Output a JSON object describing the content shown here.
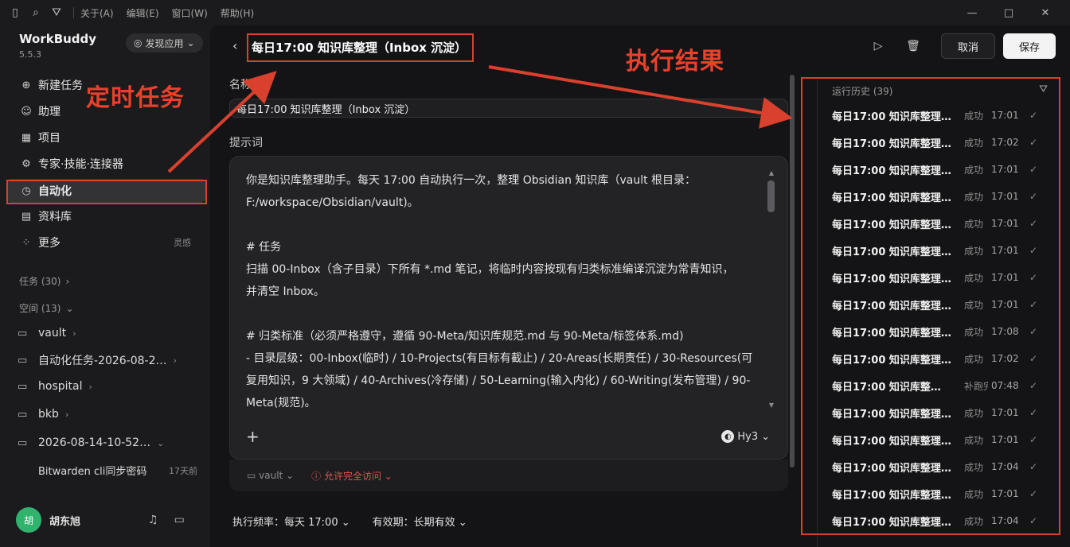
{
  "topbar": {
    "menus": [
      "关于(A)",
      "编辑(E)",
      "窗口(W)",
      "帮助(H)"
    ]
  },
  "app": {
    "name": "WorkBuddy",
    "version": "5.5.3",
    "discover_label": "发现应用"
  },
  "nav": [
    {
      "label": "新建任务",
      "icon": "plus-circle-icon"
    },
    {
      "label": "助理",
      "icon": "robot-icon"
    },
    {
      "label": "项目",
      "icon": "grid-icon"
    },
    {
      "label": "专家·技能·连接器",
      "icon": "puzzle-icon"
    },
    {
      "label": "自动化",
      "icon": "clock-icon"
    },
    {
      "label": "资料库",
      "icon": "book-icon"
    },
    {
      "label": "更多",
      "icon": "apps-icon",
      "aside": "灵感"
    }
  ],
  "sections": {
    "tasks": "任务 (30)",
    "spaces": "空间 (13)"
  },
  "folders": [
    {
      "label": "vault"
    },
    {
      "label": "自动化任务-2026-08-2…"
    },
    {
      "label": "hospital"
    },
    {
      "label": "bkb"
    },
    {
      "label": "2026-08-14-10-52…"
    }
  ],
  "subitem": {
    "label": "Bitwarden cli同步密码",
    "ago": "17天前"
  },
  "user": {
    "name": "胡东旭",
    "avatar_text": "胡"
  },
  "task": {
    "title": "每日17:00 知识库整理（Inbox 沉淀）",
    "name_label": "名称",
    "name_value": "每日17:00 知识库整理（Inbox 沉淀）",
    "prompt_label": "提示词",
    "prompt_lines": [
      "你是知识库整理助手。每天 17:00 自动执行一次，整理 Obsidian 知识库（vault 根目录：",
      "F:/workspace/Obsidian/vault)。",
      "",
      "# 任务",
      "扫描 00-Inbox（含子目录）下所有 *.md 笔记，将临时内容按现有归类标准编译沉淀为常青知识，",
      "并清空 Inbox。",
      "",
      "# 归类标准（必须严格遵守，遵循 90-Meta/知识库规范.md 与 90-Meta/标签体系.md)",
      "- 目录层级：00-Inbox(临时) / 10-Projects(有目标有截止) / 20-Areas(长期责任) / 30-Resources(可",
      "复用知识，9 大领域) / 40-Archives(冷存储) / 50-Learning(输入内化) / 60-Writing(发布管理) / 90-",
      "Meta(规范)。"
    ],
    "model": "Hy3",
    "workspace": "vault",
    "access": "允许完全访问",
    "frequency": "执行频率：每天 17:00",
    "validity": "有效期：长期有效"
  },
  "actions": {
    "cancel": "取消",
    "save": "保存"
  },
  "history": {
    "title": "运行历史 (39)",
    "rows": [
      {
        "name": "每日17:00 知识库整理…",
        "status": "成功",
        "time": "17:01"
      },
      {
        "name": "每日17:00 知识库整理…",
        "status": "成功",
        "time": "17:02"
      },
      {
        "name": "每日17:00 知识库整理…",
        "status": "成功",
        "time": "17:01"
      },
      {
        "name": "每日17:00 知识库整理…",
        "status": "成功",
        "time": "17:01"
      },
      {
        "name": "每日17:00 知识库整理…",
        "status": "成功",
        "time": "17:01"
      },
      {
        "name": "每日17:00 知识库整理…",
        "status": "成功",
        "time": "17:01"
      },
      {
        "name": "每日17:00 知识库整理…",
        "status": "成功",
        "time": "17:01"
      },
      {
        "name": "每日17:00 知识库整理…",
        "status": "成功",
        "time": "17:01"
      },
      {
        "name": "每日17:00 知识库整理…",
        "status": "成功",
        "time": "17:08"
      },
      {
        "name": "每日17:00 知识库整理…",
        "status": "成功",
        "time": "17:02"
      },
      {
        "name": "每日17:00 知识库整…",
        "status": "补跑完成",
        "time": "07:48"
      },
      {
        "name": "每日17:00 知识库整理…",
        "status": "成功",
        "time": "17:01"
      },
      {
        "name": "每日17:00 知识库整理…",
        "status": "成功",
        "time": "17:01"
      },
      {
        "name": "每日17:00 知识库整理…",
        "status": "成功",
        "time": "17:04"
      },
      {
        "name": "每日17:00 知识库整理…",
        "status": "成功",
        "time": "17:01"
      },
      {
        "name": "每日17:00 知识库整理…",
        "status": "成功",
        "time": "17:04"
      }
    ]
  },
  "annotations": {
    "scheduled": "定时任务",
    "result": "执行结果"
  },
  "colors": {
    "accent_red": "#d9402e",
    "avatar_green": "#2fb36d"
  }
}
